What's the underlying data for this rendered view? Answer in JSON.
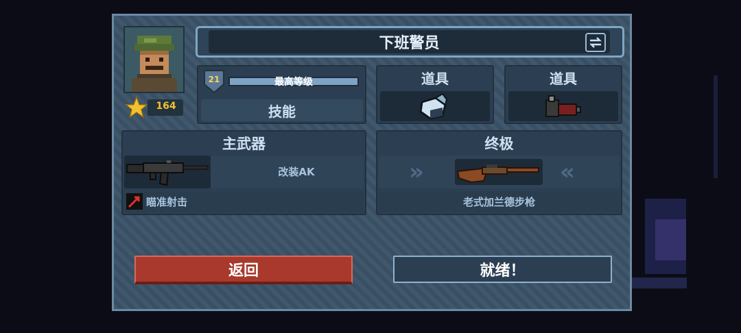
{
  "character": {
    "name": "下班警员",
    "stars": "164",
    "level": "21",
    "level_label": "最高等级",
    "skill_label": "技能"
  },
  "items": [
    {
      "label": "道具",
      "icon": "potion-icon"
    },
    {
      "label": "道具",
      "icon": "grenade-icon"
    }
  ],
  "primary_weapon": {
    "header": "主武器",
    "name": "改装AK",
    "perk": "瞄准射击"
  },
  "ultimate": {
    "header": "终极",
    "name": "老式加兰德步枪"
  },
  "buttons": {
    "back": "返回",
    "ready": "就绪！"
  },
  "colors": {
    "panel": "#3b5267",
    "back_button": "#a8392c",
    "star": "#f2c12e"
  }
}
